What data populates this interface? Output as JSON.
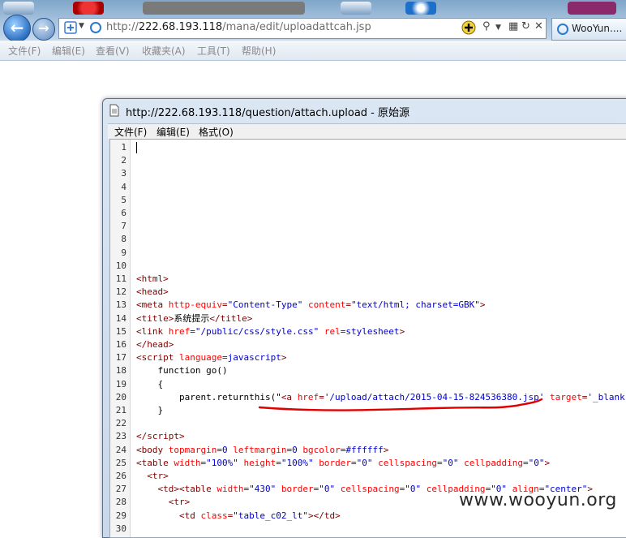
{
  "browser": {
    "address_prefix": "http://",
    "address_host": "222.68.193.118",
    "address_path": "/mana/edit/uploadattcah.jsp",
    "tab_label": "WooYun....",
    "menu": [
      "文件(F)",
      "编辑(E)",
      "查看(V)",
      "收藏夹(A)",
      "工具(T)",
      "帮助(H)"
    ]
  },
  "source_window": {
    "title": "http://222.68.193.118/question/attach.upload - 原始源",
    "menu": [
      "文件(F)",
      "编辑(E)",
      "格式(O)"
    ]
  },
  "code_lines": [
    {
      "n": "1",
      "html": ""
    },
    {
      "n": "2",
      "html": ""
    },
    {
      "n": "3",
      "html": ""
    },
    {
      "n": "4",
      "html": ""
    },
    {
      "n": "5",
      "html": ""
    },
    {
      "n": "6",
      "html": ""
    },
    {
      "n": "7",
      "html": ""
    },
    {
      "n": "8",
      "html": ""
    },
    {
      "n": "9",
      "html": ""
    },
    {
      "n": "10",
      "html": ""
    },
    {
      "n": "11",
      "html": "<span class='tag'>&lt;html&gt;</span>"
    },
    {
      "n": "12",
      "html": "<span class='tag'>&lt;head&gt;</span>"
    },
    {
      "n": "13",
      "html": "<span class='tag'>&lt;meta </span><span class='attr'>http-equiv</span><span class='tag'>=</span><span class='val'>\"Content-Type\"</span><span class='tag'> </span><span class='attr'>content</span><span class='tag'>=</span><span class='val'>\"text/html; charset=GBK\"</span><span class='tag'>&gt;</span>"
    },
    {
      "n": "14",
      "html": "<span class='tag'>&lt;title&gt;</span><span class='plain'>系统提示</span><span class='tag'>&lt;/title&gt;</span>"
    },
    {
      "n": "15",
      "html": "<span class='tag'>&lt;link </span><span class='attr'>href</span><span class='tag'>=</span><span class='val'>\"/public/css/style.css\"</span><span class='tag'> </span><span class='attr'>rel</span><span class='tag'>=</span><span class='val'>stylesheet</span><span class='tag'>&gt;</span>"
    },
    {
      "n": "16",
      "html": "<span class='tag'>&lt;/head&gt;</span>"
    },
    {
      "n": "17",
      "html": "<span class='tag'>&lt;script </span><span class='attr'>language</span><span class='tag'>=</span><span class='val'>javascript</span><span class='tag'>&gt;</span>"
    },
    {
      "n": "18",
      "html": "<span class='plain'>    function go()</span>"
    },
    {
      "n": "19",
      "html": "<span class='plain'>    {</span>"
    },
    {
      "n": "20",
      "html": "<span class='plain'>        parent.returnthis(\"</span><span class='tag'>&lt;a </span><span class='attr'>href</span><span class='tag'>=</span><span class='val'>'/upload/attach/2015-04-15-824536380.jsp'</span><span class='tag'> </span><span class='attr'>target</span><span class='tag'>=</span><span class='val'>'_blank'</span><span class='tag'>&gt;</span><span class='tag'>查看附件</span>"
    },
    {
      "n": "21",
      "html": "<span class='plain'>    }</span>"
    },
    {
      "n": "22",
      "html": ""
    },
    {
      "n": "23",
      "html": "<span class='tag'>&lt;/script&gt;</span>"
    },
    {
      "n": "24",
      "html": "<span class='tag'>&lt;body </span><span class='attr'>topmargin</span><span class='tag'>=</span><span class='val'>0</span><span class='tag'> </span><span class='attr'>leftmargin</span><span class='tag'>=</span><span class='val'>0</span><span class='tag'> </span><span class='attr'>bgcolor</span><span class='tag'>=</span><span class='val'>#ffffff</span><span class='tag'>&gt;</span>"
    },
    {
      "n": "25",
      "html": "<span class='tag'>&lt;table </span><span class='attr'>width</span><span class='tag'>=</span><span class='val'>\"100%\"</span><span class='tag'> </span><span class='attr'>height</span><span class='tag'>=</span><span class='val'>\"100%\"</span><span class='tag'> </span><span class='attr'>border</span><span class='tag'>=</span><span class='val'>\"0\"</span><span class='tag'> </span><span class='attr'>cellspacing</span><span class='tag'>=</span><span class='val'>\"0\"</span><span class='tag'> </span><span class='attr'>cellpadding</span><span class='tag'>=</span><span class='val'>\"0\"</span><span class='tag'>&gt;</span>"
    },
    {
      "n": "26",
      "html": "<span class='tag'>  &lt;tr&gt;</span>"
    },
    {
      "n": "27",
      "html": "<span class='tag'>    &lt;td&gt;&lt;table </span><span class='attr'>width</span><span class='tag'>=</span><span class='val'>\"430\"</span><span class='tag'> </span><span class='attr'>border</span><span class='tag'>=</span><span class='val'>\"0\"</span><span class='tag'> </span><span class='attr'>cellspacing</span><span class='tag'>=</span><span class='val'>\"0\"</span><span class='tag'> </span><span class='attr'>cellpadding</span><span class='tag'>=</span><span class='val'>\"0\"</span><span class='tag'> </span><span class='attr'>align</span><span class='tag'>=</span><span class='val'>\"center\"</span><span class='tag'>&gt;</span>"
    },
    {
      "n": "28",
      "html": "<span class='tag'>      &lt;tr&gt;</span>"
    },
    {
      "n": "29",
      "html": "<span class='tag'>        &lt;td </span><span class='attr'>class</span><span class='tag'>=</span><span class='val'>\"table_c02_lt\"</span><span class='tag'>&gt;&lt;/td&gt;</span>"
    },
    {
      "n": "30",
      "html": ""
    }
  ],
  "watermark": "www.wooyun.org"
}
